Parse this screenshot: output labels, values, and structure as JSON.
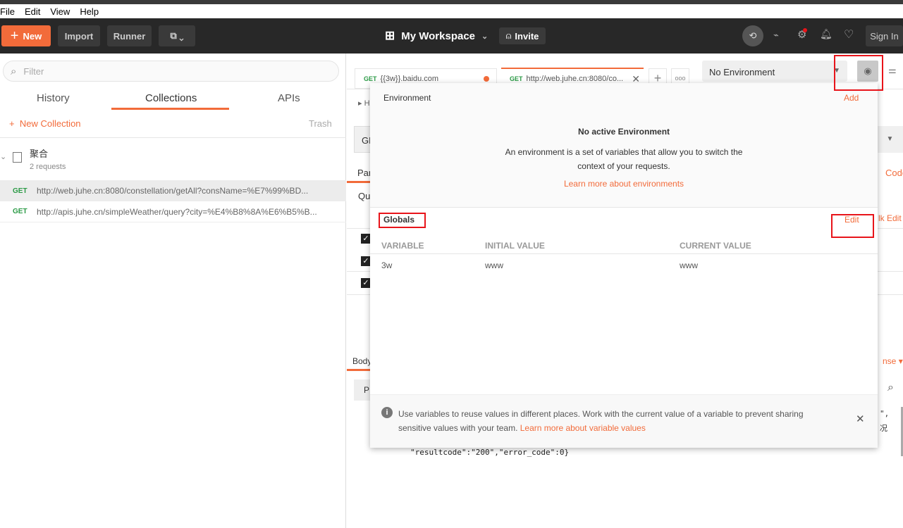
{
  "menu": [
    "File",
    "Edit",
    "View",
    "Help"
  ],
  "header": {
    "new_label": "New",
    "import_label": "Import",
    "runner_label": "Runner",
    "workspace": "My Workspace",
    "invite": "Invite",
    "sign_in": "Sign In"
  },
  "sidebar": {
    "filter_placeholder": "Filter",
    "tabs": [
      "History",
      "Collections",
      "APIs"
    ],
    "active_tab": "Collections",
    "new_collection": "New Collection",
    "trash": "Trash",
    "collection": {
      "name": "聚合",
      "count": "2 requests",
      "requests": [
        {
          "method": "GET",
          "url": "http://web.juhe.cn:8080/constellation/getAll?consName=%E7%99%BD..."
        },
        {
          "method": "GET",
          "url": "http://apis.juhe.cn/simpleWeather/query?city=%E4%B8%8A%E6%B5%B..."
        }
      ]
    }
  },
  "tabs": [
    {
      "method": "GET",
      "label": "{{3w}}.baidu.com"
    },
    {
      "method": "GET",
      "label": "http://web.juhe.cn:8080/co..."
    }
  ],
  "environment_select": "No Environment",
  "background": {
    "request_name": "H",
    "method": "GE",
    "params": "Par",
    "query": "Qu",
    "code": "Code",
    "bulk_edit": "lk Edit",
    "body": "Body",
    "pretty": "P",
    "response": "nse",
    "response_text": "\"resultcode\":\"200\",\"error_code\":0}",
    "frag1": "\",",
    "frag2": "况"
  },
  "popup": {
    "env_title": "Environment",
    "add": "Add",
    "no_env_title": "No active Environment",
    "no_env_desc1": "An environment is a set of variables that allow you to switch the",
    "no_env_desc2": "context of your requests.",
    "learn_env": "Learn more about environments",
    "globals_title": "Globals",
    "edit": "Edit",
    "columns": [
      "VARIABLE",
      "INITIAL VALUE",
      "CURRENT VALUE"
    ],
    "rows": [
      {
        "variable": "3w",
        "initial": "www",
        "current": "www"
      }
    ],
    "info_text1": "Use variables to reuse values in different places. Work with the current value of a variable to prevent sharing",
    "info_text2": "sensitive values with your team.",
    "learn_vars": "Learn more about variable values"
  },
  "colors": {
    "accent": "#f26b3a",
    "header": "#282828",
    "annotation": "#e8141a"
  }
}
